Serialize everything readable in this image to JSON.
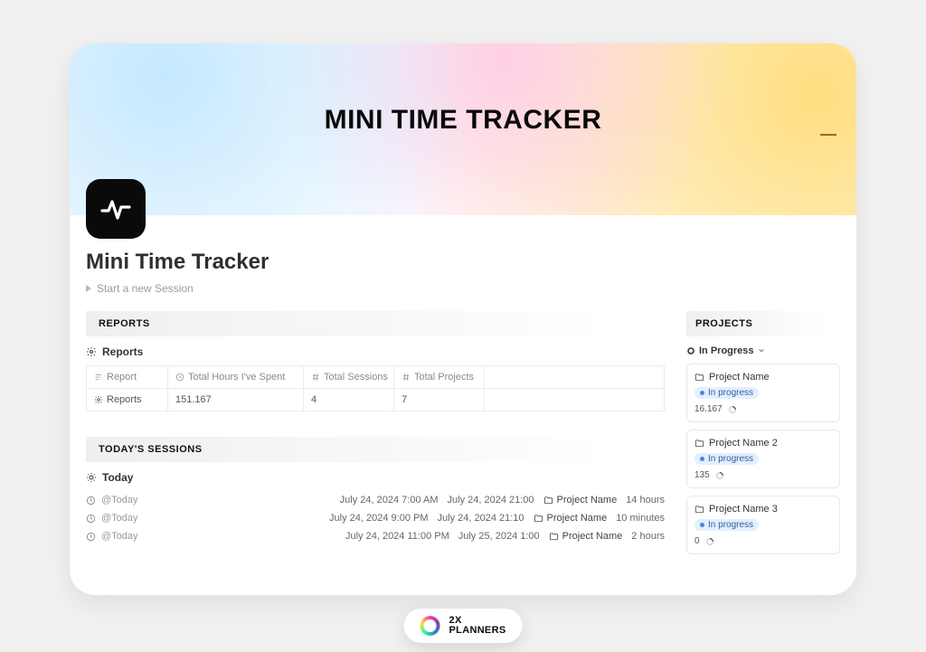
{
  "hero": {
    "title": "MINI TIME TRACKER"
  },
  "page": {
    "title": "Mini Time Tracker",
    "start_label": "Start a new Session"
  },
  "reports": {
    "section_label": "REPORTS",
    "view_label": "Reports",
    "columns": {
      "report": "Report",
      "hours": "Total Hours I've Spent",
      "sessions": "Total Sessions",
      "projects": "Total Projects"
    },
    "row": {
      "name": "Reports",
      "hours": "151.167",
      "sessions": "4",
      "projects": "7"
    }
  },
  "sessions": {
    "section_label": "TODAY'S SESSIONS",
    "view_label": "Today",
    "rows": [
      {
        "label": "@Today",
        "start": "July 24, 2024 7:00 AM",
        "end": "July 24, 2024 21:00",
        "project": "Project Name",
        "duration": "14 hours"
      },
      {
        "label": "@Today",
        "start": "July 24, 2024 9:00 PM",
        "end": "July 24, 2024 21:10",
        "project": "Project Name",
        "duration": "10 minutes"
      },
      {
        "label": "@Today",
        "start": "July 24, 2024 11:00 PM",
        "end": "July 25, 2024 1:00",
        "project": "Project Name",
        "duration": "2 hours"
      }
    ]
  },
  "projects": {
    "section_label": "PROJECTS",
    "view_label": "In Progress",
    "status_label": "In progress",
    "items": [
      {
        "name": "Project Name",
        "hours": "16.167"
      },
      {
        "name": "Project Name 2",
        "hours": "135"
      },
      {
        "name": "Project Name 3",
        "hours": "0"
      }
    ]
  },
  "footer": {
    "brand_top": "2X",
    "brand_bottom": "PLANNERS"
  }
}
